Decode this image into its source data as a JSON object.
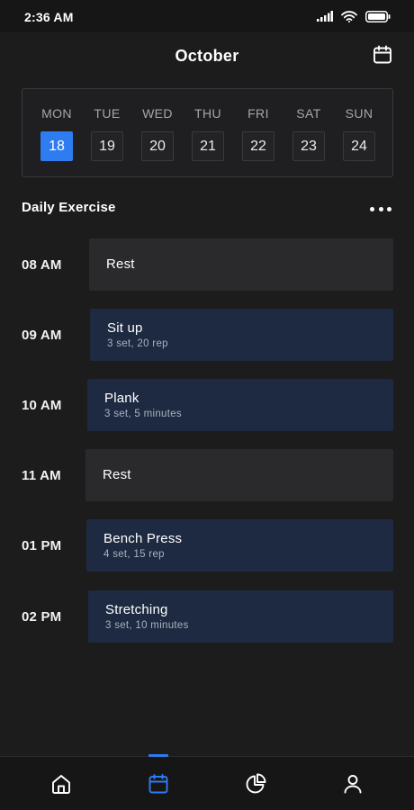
{
  "status_bar": {
    "time": "2:36 AM"
  },
  "header": {
    "month": "October"
  },
  "week": [
    {
      "day": "MON",
      "date": "18",
      "selected": true
    },
    {
      "day": "TUE",
      "date": "19",
      "selected": false
    },
    {
      "day": "WED",
      "date": "20",
      "selected": false
    },
    {
      "day": "THU",
      "date": "21",
      "selected": false
    },
    {
      "day": "FRI",
      "date": "22",
      "selected": false
    },
    {
      "day": "SAT",
      "date": "23",
      "selected": false
    },
    {
      "day": "SUN",
      "date": "24",
      "selected": false
    }
  ],
  "section": {
    "title": "Daily Exercise"
  },
  "schedule": [
    {
      "time": "08 AM",
      "name": "Rest",
      "detail": ""
    },
    {
      "time": "09 AM",
      "name": "Sit up",
      "detail": "3 set, 20 rep"
    },
    {
      "time": "10 AM",
      "name": "Plank",
      "detail": "3 set, 5 minutes"
    },
    {
      "time": "11 AM",
      "name": "Rest",
      "detail": ""
    },
    {
      "time": "01 PM",
      "name": "Bench Press",
      "detail": "4 set, 15 rep"
    },
    {
      "time": "02 PM",
      "name": "Stretching",
      "detail": "3 set, 10 minutes"
    }
  ],
  "nav": [
    {
      "icon": "home-icon",
      "active": false
    },
    {
      "icon": "calendar-icon",
      "active": true
    },
    {
      "icon": "pie-chart-icon",
      "active": false
    },
    {
      "icon": "profile-icon",
      "active": false
    }
  ],
  "colors": {
    "accent": "#2f7bf0",
    "background": "#1c1c1d",
    "card": "#2a2a2c",
    "card_active": "#1e2a41"
  }
}
